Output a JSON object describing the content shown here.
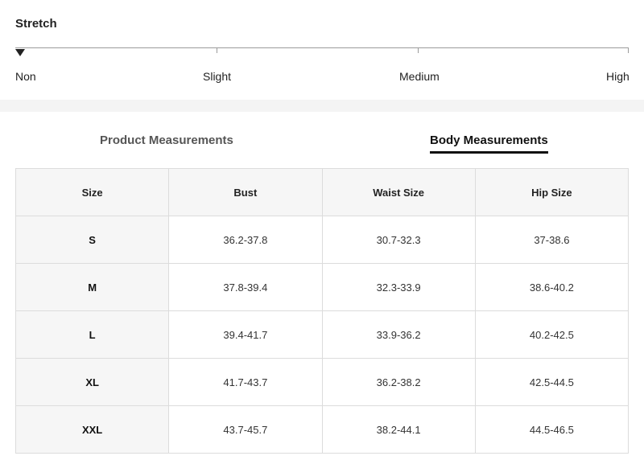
{
  "stretch": {
    "title": "Stretch",
    "levels": [
      "Non",
      "Slight",
      "Medium",
      "High"
    ],
    "selected": "Non"
  },
  "tabs": [
    {
      "label": "Product Measurements",
      "active": false
    },
    {
      "label": "Body Measurements",
      "active": true
    }
  ],
  "table": {
    "headers": [
      "Size",
      "Bust",
      "Waist Size",
      "Hip Size"
    ],
    "rows": [
      [
        "S",
        "36.2-37.8",
        "30.7-32.3",
        "37-38.6"
      ],
      [
        "M",
        "37.8-39.4",
        "32.3-33.9",
        "38.6-40.2"
      ],
      [
        "L",
        "39.4-41.7",
        "33.9-36.2",
        "40.2-42.5"
      ],
      [
        "XL",
        "41.7-43.7",
        "36.2-38.2",
        "42.5-44.5"
      ],
      [
        "XXL",
        "43.7-45.7",
        "38.2-44.1",
        "44.5-46.5"
      ]
    ]
  },
  "colors": {
    "accent": "#111111",
    "band": "#f4f4f4",
    "header_bg": "#f6f6f6",
    "border": "#dcdcdc"
  },
  "icons": {
    "pointer": "down-triangle"
  }
}
